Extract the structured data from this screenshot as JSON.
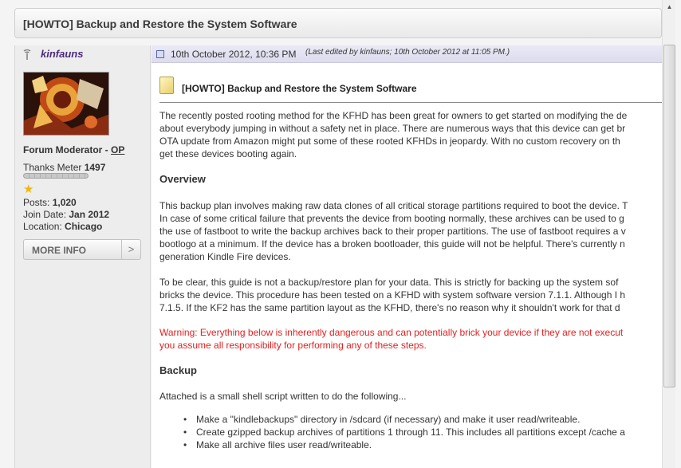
{
  "thread": {
    "title": "[HOWTO] Backup and Restore the System Software"
  },
  "user": {
    "name": "kinfauns",
    "rank": "Forum Moderator -",
    "op": "OP",
    "thanks_label": "Thanks Meter",
    "thanks_value": "1497",
    "posts_label": "Posts:",
    "posts_value": "1,020",
    "join_label": "Join Date:",
    "join_value": "Jan 2012",
    "location_label": "Location:",
    "location_value": "Chicago",
    "more_info": "MORE INFO",
    "more_info_arrow": ">"
  },
  "post": {
    "date": "10th October 2012, 10:36 PM",
    "edited": "(Last edited by kinfauns; 10th October 2012 at 11:05 PM.)",
    "title": "[HOWTO] Backup and Restore the System Software",
    "intro": [
      "The recently posted rooting method for the KFHD has been great for owners to get started on modifying the de",
      "about everybody jumping in without a safety net in place. There are numerous ways that this device can get br",
      "OTA update from Amazon might put some of these rooted KFHDs in jeopardy. With no custom recovery on th",
      "get these devices booting again."
    ],
    "overview_heading": "Overview",
    "overview": [
      "This backup plan involves making raw data clones of all critical storage partitions required to boot the device. T",
      "In case of some critical failure that prevents the device from booting normally, these archives can be used to g",
      "the use of fastboot to write the backup archives back to their proper partitions. The use of fastboot requires a v",
      "bootlogo at a minimum. If the device has a broken bootloader, this guide will not be helpful. There's currently n",
      "generation Kindle Fire devices."
    ],
    "clarify": [
      "To be clear, this guide is not a backup/restore plan for your data. This is strictly for backing up the system sof",
      "bricks the device. This procedure has been tested on a KFHD with system software version 7.1.1. Although I h",
      "7.1.5. If the KF2 has the same partition layout as the KFHD, there's no reason why it shouldn't work for that d"
    ],
    "warning": [
      "Warning: Everything below is inherently dangerous and can potentially brick your device if they are not execut",
      "you assume all responsibility for performing any of these steps."
    ],
    "backup_heading": "Backup",
    "backup_intro": "Attached is a small shell script written to do the following...",
    "bullets": [
      "Make a \"kindlebackups\" directory in /sdcard (if necessary) and make it user read/writeable.",
      "Create gzipped backup archives of partitions 1 through 11. This includes all partitions except /cache a",
      "Make all archive files user read/writeable."
    ]
  },
  "scroll": {
    "up_arrow": "▲"
  },
  "colors": {
    "username": "#4b2a7d",
    "warning": "#e12121",
    "header_band": "#dcdcee"
  }
}
